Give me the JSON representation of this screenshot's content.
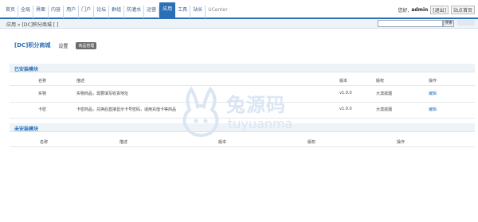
{
  "nav": {
    "items": [
      "首页",
      "全局",
      "界面",
      "内容",
      "用户",
      "门户",
      "论坛",
      "群组",
      "防灌水",
      "运营",
      "应用",
      "工具",
      "站长",
      "UCenter"
    ],
    "active_index": 10
  },
  "user": {
    "greeting": "您好,",
    "name": "admin",
    "logout": "[退出]",
    "site_link": "站点首页"
  },
  "subbar": {
    "breadcrumb": "应用 » [DC]积分商城 [ ]",
    "search_button": "搜索"
  },
  "plugin": {
    "title": "[DC]积分商城",
    "menu_settings": "设置",
    "menu_active": "商品管理"
  },
  "installed": {
    "section_title": "已安装模块",
    "columns": [
      "名称",
      "描述",
      "",
      "版本",
      "版权",
      "操作"
    ],
    "rows": [
      {
        "name": "实物",
        "desc": "实物商品，需要填写收货地址",
        "version": "v1.0.0",
        "copyright": "大漠孤烟",
        "action": "编辑"
      },
      {
        "name": "卡密",
        "desc": "卡密商品，兑换后直接显示卡号密码，适用充值卡等商品",
        "version": "v1.0.0",
        "copyright": "大漠孤烟",
        "action": "编辑"
      }
    ]
  },
  "uninstalled": {
    "section_title": "未安装模块",
    "columns": [
      "名称",
      "描述",
      "版本",
      "版权",
      "操作"
    ]
  },
  "watermark": {
    "text": "兔源码",
    "sub": "tuyuanma"
  }
}
